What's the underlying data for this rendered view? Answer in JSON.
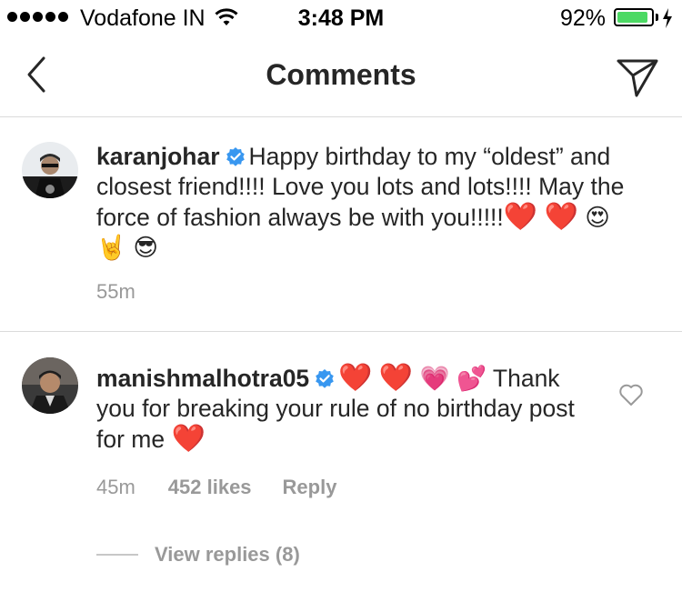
{
  "status_bar": {
    "carrier": "Vodafone IN",
    "time": "3:48 PM",
    "battery_percent": "92%",
    "battery_level": 0.92,
    "battery_color": "#4cd964"
  },
  "nav": {
    "title": "Comments",
    "back_icon": "chevron-left-icon",
    "send_icon": "paper-plane-icon"
  },
  "comments": [
    {
      "username": "karanjohar",
      "verified": true,
      "text_line1": "Happy birthday to my",
      "text_rest": "“oldest” and closest friend!!!! Love you lots and lots!!!! May the force of fashion always be with you!!!!!",
      "emojis": [
        "❤️",
        "❤️",
        "😍",
        "🤘",
        "😎"
      ],
      "time": "55m"
    },
    {
      "username": "manishmalhotra05",
      "verified": true,
      "emojis_inline": [
        "❤️",
        "❤️",
        "💗",
        "💕"
      ],
      "text": "Thank you for breaking your rule of no birthday post for me",
      "trailing_emoji": "❤️",
      "time": "45m",
      "likes": "452 likes",
      "reply_label": "Reply",
      "view_replies": "View replies (8)"
    }
  ],
  "colors": {
    "verified_blue": "#3897f0",
    "secondary_text": "#999999",
    "divider": "#dbdbdb"
  }
}
